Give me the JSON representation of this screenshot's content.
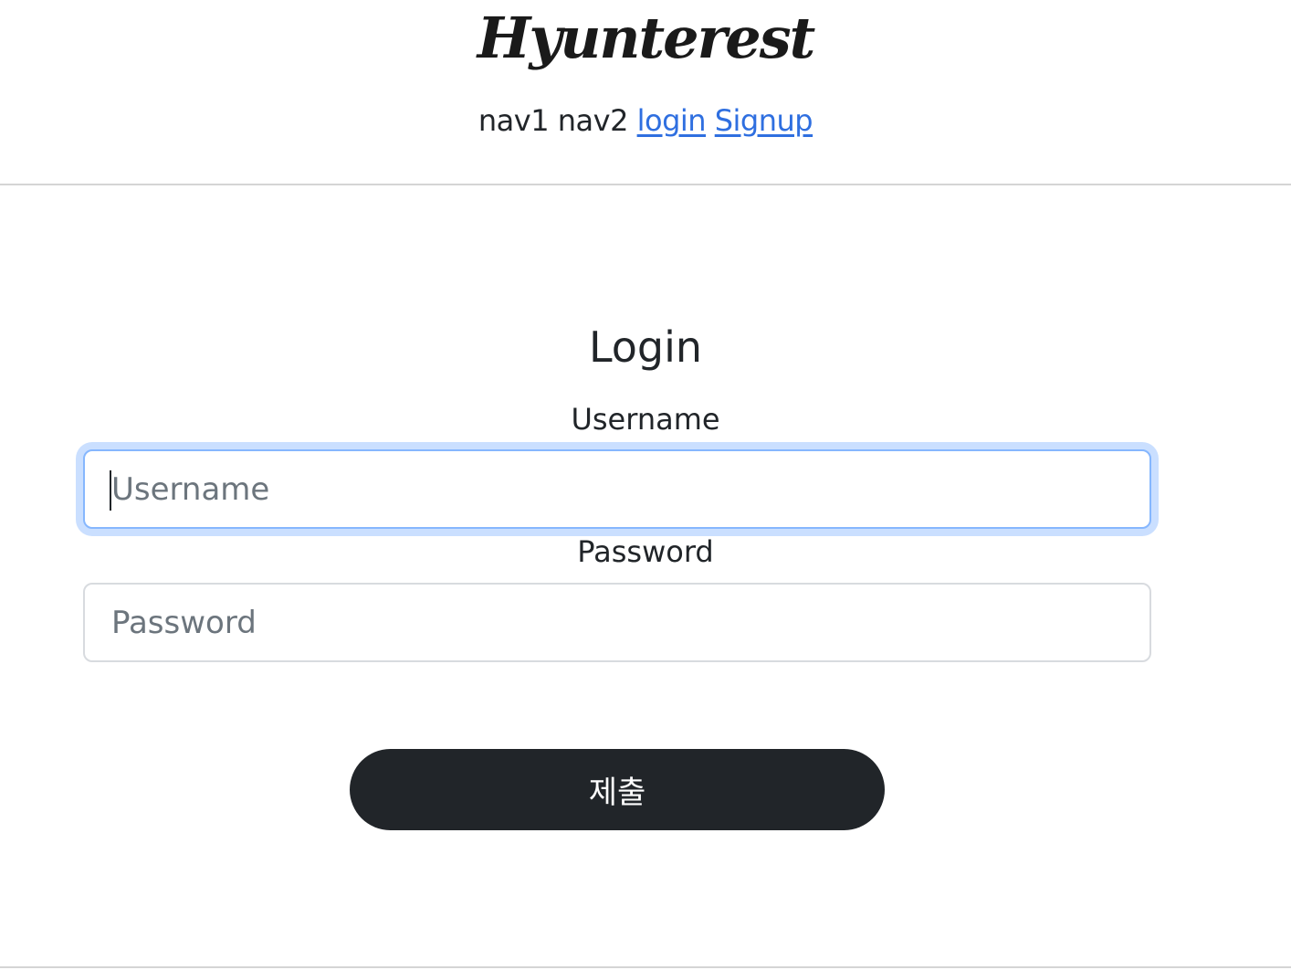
{
  "header": {
    "logo": "Hyunterest",
    "nav": {
      "item1": "nav1",
      "item2": "nav2",
      "login": "login",
      "signup": "Signup"
    }
  },
  "form": {
    "title": "Login",
    "username": {
      "label": "Username",
      "placeholder": "Username",
      "value": ""
    },
    "password": {
      "label": "Password",
      "placeholder": "Password",
      "value": ""
    },
    "submit_label": "제출"
  },
  "colors": {
    "link": "#2f6fe0",
    "button_bg": "#212529",
    "focus_border": "#86b7fe",
    "divider": "#d5d5d5"
  }
}
